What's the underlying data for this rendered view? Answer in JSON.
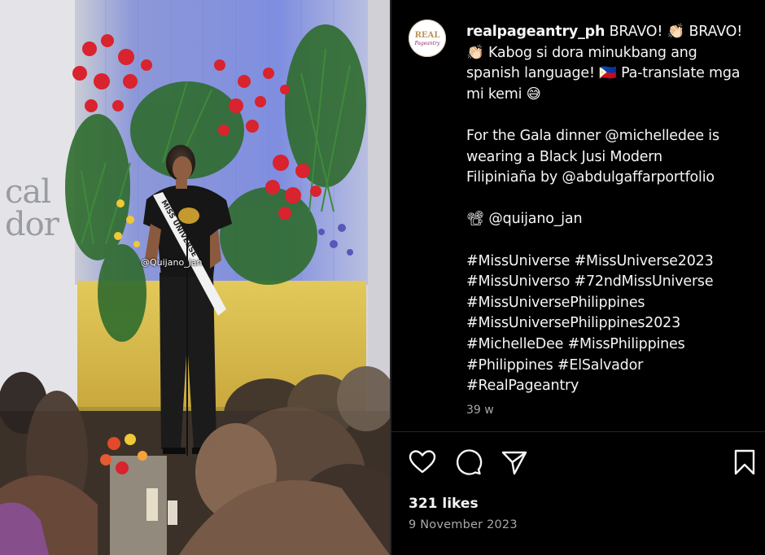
{
  "post": {
    "username": "realpageantry_ph",
    "avatar_text_top": "REAL",
    "avatar_text_bottom": "Pageantry",
    "caption_lines": [
      "BRAVO! 👏🏻 BRAVO!",
      "👏🏻 Kabog si dora minukbang ang",
      "spanish language! 🇵🇭 Pa-translate mga",
      "mi kemi 😅",
      "",
      "For the Gala dinner @michelledee is",
      "wearing a Black Jusi Modern",
      "Filipiniaña by @abdulgaffarportfolio",
      "",
      "📽 @quijano_jan",
      "",
      "#MissUniverse #MissUniverse2023",
      "#MissUniverso #72ndMissUniverse",
      "#MissUniversePhilippines",
      "#MissUniversePhilippines2023",
      "#MichelleDee #MissPhilippines",
      "#Philippines #ElSalvador",
      "#RealPageantry"
    ],
    "time_ago": "39 w",
    "likes": "321 likes",
    "date": "9 November 2023"
  },
  "media": {
    "watermark": "@Quijano_jan",
    "wall_text_line1": "cal",
    "wall_text_line2": "dor",
    "sash_text": "MISS UNIVERSE"
  },
  "actions": {
    "icons": [
      "heart-icon",
      "comment-icon",
      "share-icon",
      "bookmark-icon"
    ]
  },
  "colors": {
    "background": "#000000",
    "text": "#f5f5f5",
    "muted": "#a8a8a8",
    "divider": "#262626"
  }
}
